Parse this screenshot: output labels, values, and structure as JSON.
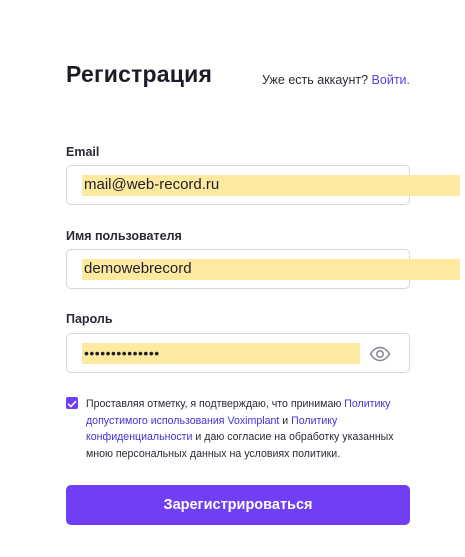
{
  "header": {
    "title": "Регистрация",
    "login_prompt": "Уже есть аккаунт?",
    "login_link": "Войти."
  },
  "form": {
    "email": {
      "label": "Email",
      "value": "mail@web-record.ru"
    },
    "username": {
      "label": "Имя пользователя",
      "value": "demowebrecord"
    },
    "password": {
      "label": "Пароль",
      "masked_value": "••••••••••••••",
      "toggle_icon": "eye-icon"
    }
  },
  "consent": {
    "checked": true,
    "text_1": "Проставляя отметку, я подтверждаю, что принимаю ",
    "link_1": "Политику допустимого использования Voximplant",
    "text_2": " и ",
    "link_2": "Политику конфиденциальности",
    "text_3": " и даю согласие на обработку указанных мною персональных данных на условиях политики."
  },
  "submit": {
    "label": "Зарегистрироваться"
  },
  "colors": {
    "accent": "#6f3ef5",
    "link": "#5a3ee6",
    "highlight": "#fde9a0"
  }
}
